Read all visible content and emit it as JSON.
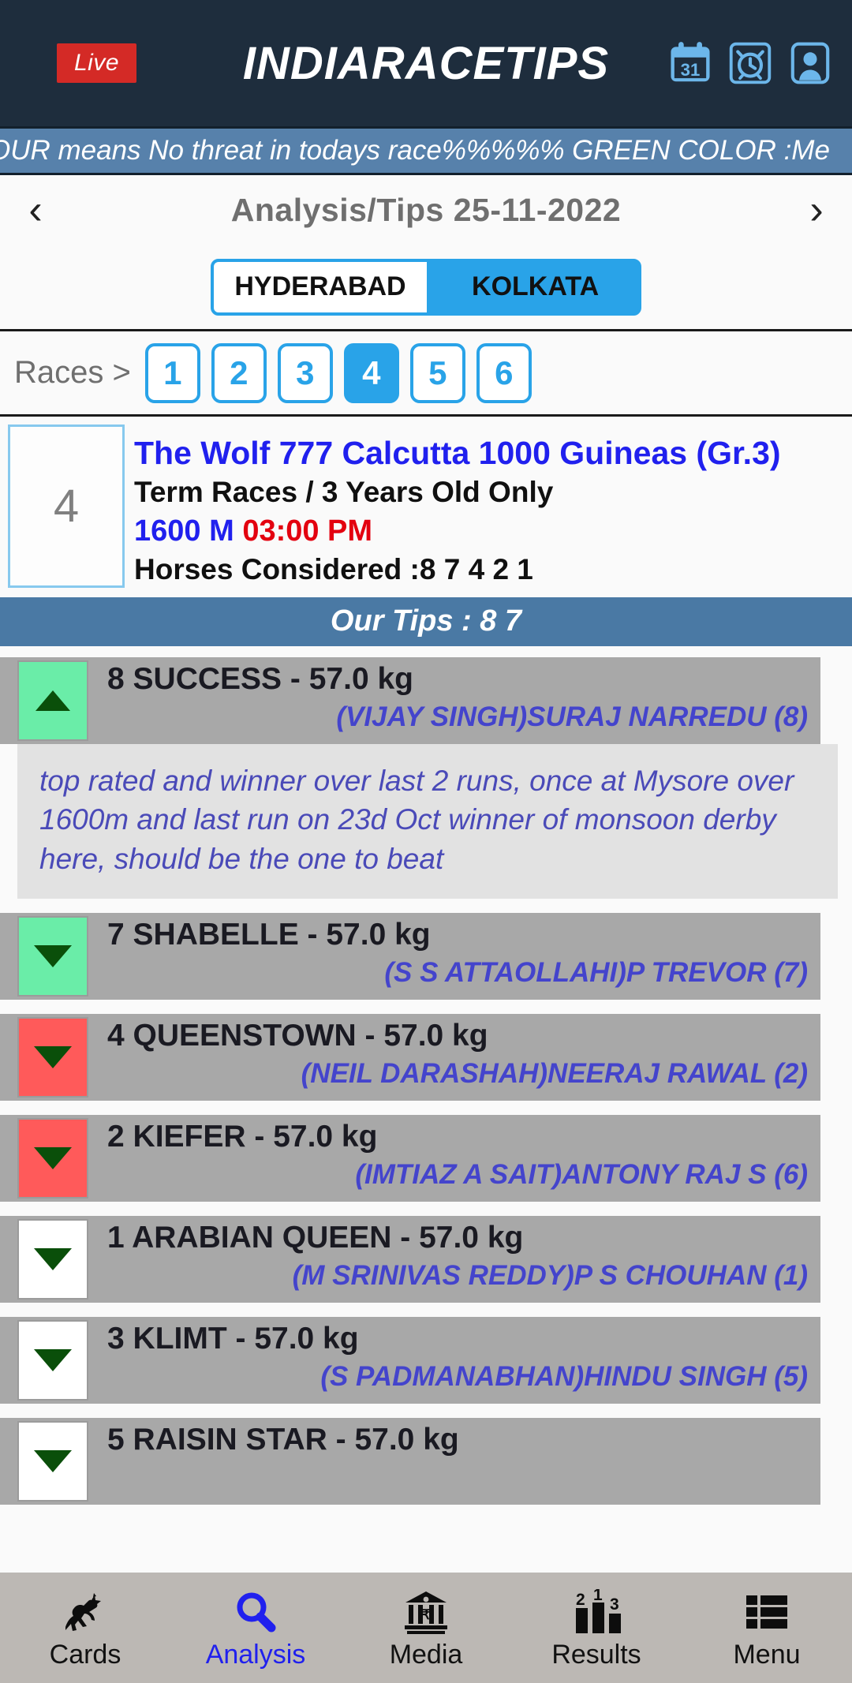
{
  "header": {
    "live_label": "Live",
    "brand": "INDIARACETIPS",
    "icons": [
      {
        "name": "calendar-icon",
        "label": "31"
      },
      {
        "name": "alarm-clock-icon",
        "label": ""
      },
      {
        "name": "profile-icon",
        "label": ""
      }
    ]
  },
  "marquee": {
    "text": "OUR means No threat in todays race%%%%% GREEN COLOR :Me"
  },
  "datenav": {
    "prev": "‹",
    "next": "›",
    "title": "Analysis/Tips  25-11-2022"
  },
  "venues": [
    {
      "label": "HYDERABAD",
      "active": false
    },
    {
      "label": "KOLKATA",
      "active": true
    }
  ],
  "races": {
    "label": "Races >",
    "pills": [
      {
        "label": "1",
        "active": false
      },
      {
        "label": "2",
        "active": false
      },
      {
        "label": "3",
        "active": false
      },
      {
        "label": "4",
        "active": true
      },
      {
        "label": "5",
        "active": false
      },
      {
        "label": "6",
        "active": false
      }
    ]
  },
  "race": {
    "number": "4",
    "title": "The Wolf 777 Calcutta 1000 Guineas (Gr.3)",
    "conditions": "Term Races / 3 Years Old Only",
    "distance": "1600 M",
    "time": "03:00 PM",
    "horses_considered": "Horses Considered :8 7 4 2 1"
  },
  "tips_bar": "Our Tips : 8 7",
  "entries": [
    {
      "flag": "green",
      "arrow": "up",
      "horse": "8  SUCCESS - 57.0 kg",
      "jockey": "(VIJAY SINGH)SURAJ NARREDU (8)",
      "comment": "top rated and winner over last 2 runs, once at Mysore over 1600m and last run on 23d Oct winner of monsoon derby here, should be the one to beat"
    },
    {
      "flag": "green",
      "arrow": "down",
      "horse": "7  SHABELLE - 57.0 kg",
      "jockey": "(S S ATTAOLLAHI)P TREVOR (7)",
      "comment": ""
    },
    {
      "flag": "red",
      "arrow": "down",
      "horse": "4  QUEENSTOWN - 57.0 kg",
      "jockey": "(NEIL DARASHAH)NEERAJ RAWAL (2)",
      "comment": ""
    },
    {
      "flag": "red",
      "arrow": "down",
      "horse": "2  KIEFER - 57.0 kg",
      "jockey": "(IMTIAZ A SAIT)ANTONY RAJ S (6)",
      "comment": ""
    },
    {
      "flag": "white",
      "arrow": "down",
      "horse": "1  ARABIAN QUEEN - 57.0 kg",
      "jockey": "(M SRINIVAS REDDY)P S CHOUHAN (1)",
      "comment": ""
    },
    {
      "flag": "white",
      "arrow": "down",
      "horse": "3  KLIMT - 57.0 kg",
      "jockey": "(S PADMANABHAN)HINDU SINGH (5)",
      "comment": ""
    },
    {
      "flag": "white",
      "arrow": "down",
      "horse": "5  RAISIN STAR - 57.0 kg",
      "jockey": "",
      "comment": ""
    }
  ],
  "bottomnav": [
    {
      "label": "Cards",
      "icon": "horse-racing-icon",
      "active": false
    },
    {
      "label": "Analysis",
      "icon": "magnifier-icon",
      "active": true
    },
    {
      "label": "Media",
      "icon": "bank-rupee-icon",
      "active": false
    },
    {
      "label": "Results",
      "icon": "podium-bars-icon",
      "active": false
    },
    {
      "label": "Menu",
      "icon": "grid-list-icon",
      "active": false
    }
  ],
  "colors": {
    "header_bg": "#1e2d3d",
    "marquee_bg": "#5781ab",
    "accent_blue": "#29a3e8",
    "tips_bar_bg": "#4a79a4",
    "live_red": "#d42a26",
    "flag_green": "#6aeda8",
    "flag_red": "#ff5a5a",
    "row_grey": "#a8a8a8",
    "comment_grey": "#e2e2e2",
    "title_blue": "#2020ee",
    "time_red": "#e3000f",
    "jockey_blue": "#4444cc",
    "bottomnav_bg": "#bcb8b4"
  }
}
